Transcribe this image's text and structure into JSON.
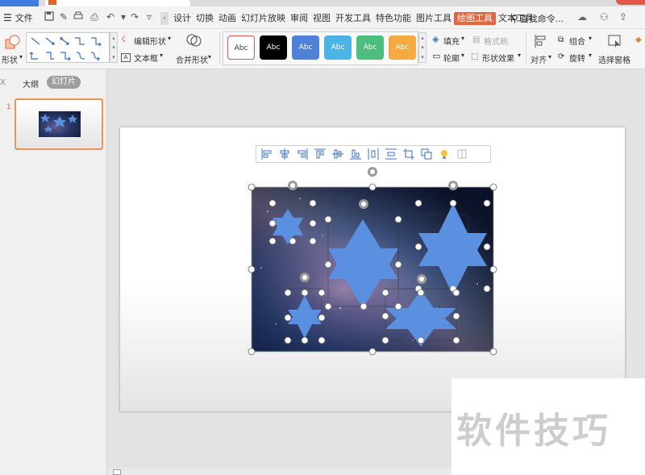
{
  "window": {
    "file_menu_label": "文件",
    "menus": [
      "设计",
      "切换",
      "动画",
      "幻灯片放映",
      "审阅",
      "视图",
      "开发工具",
      "特色功能",
      "图片工具",
      "绘图工具",
      "文本工具"
    ],
    "active_menu": "绘图工具",
    "search_command": "查找命令..."
  },
  "ribbon": {
    "shape_label": "形状",
    "edit_shape_label": "编辑形状",
    "text_box_label": "文本框",
    "merge_shapes_label": "合并形状",
    "style_samples": [
      {
        "label": "Abc",
        "bg": "#ffffff",
        "fg": "#333333",
        "border": "#d9534f"
      },
      {
        "label": "Abc",
        "bg": "#000000",
        "fg": "#ffffff",
        "border": "#000000"
      },
      {
        "label": "Abc",
        "bg": "#4f81d9",
        "fg": "#ffffff",
        "border": "#4f81d9"
      },
      {
        "label": "Abc",
        "bg": "#4bb3e6",
        "fg": "#ffffff",
        "border": "#4bb3e6"
      },
      {
        "label": "Abc",
        "bg": "#4cbf7f",
        "fg": "#ffffff",
        "border": "#4cbf7f"
      },
      {
        "label": "Abc",
        "bg": "#f5a93f",
        "fg": "#ffffff",
        "border": "#f5a93f"
      }
    ],
    "fill_label": "填充",
    "format_painter_label": "格式刷",
    "outline_label": "轮廓",
    "shape_effects_label": "形状效果",
    "align_label": "对齐",
    "group_label": "组合",
    "rotate_label": "旋转",
    "selection_pane_label": "选择窗格"
  },
  "left_panel": {
    "close_glyph": "X",
    "tab_outline": "大纲",
    "tab_slides": "幻灯片",
    "slide_number": "1"
  },
  "colors": {
    "accent": "#e8643c",
    "star_fill": "#5b8fe0",
    "active_tab": "#e8643c"
  },
  "watermark": "软件技巧"
}
